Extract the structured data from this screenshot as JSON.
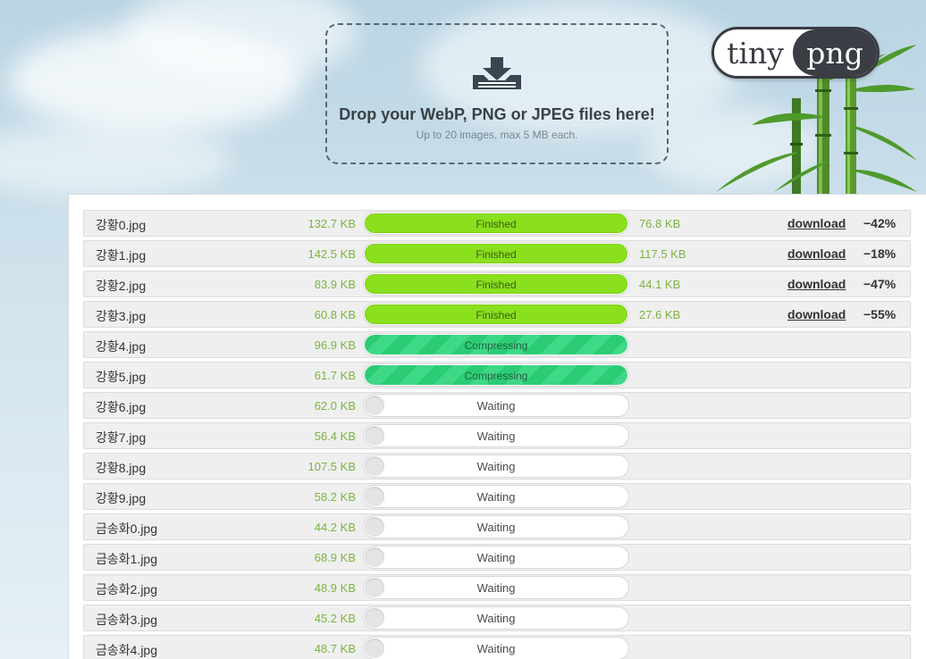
{
  "dropzone": {
    "title": "Drop your WebP, PNG or JPEG files here!",
    "subtitle": "Up to 20 images, max 5 MB each."
  },
  "logo": {
    "part1": "tiny",
    "part2": "png"
  },
  "colors": {
    "finished": "#8ae01d",
    "compressing": "#2bcc74",
    "size_text": "#7cb342"
  },
  "files": [
    {
      "name": "강황0.jpg",
      "original": "132.7 KB",
      "status": "Finished",
      "new_size": "76.8 KB",
      "download": "download",
      "savings": "−42%"
    },
    {
      "name": "강황1.jpg",
      "original": "142.5 KB",
      "status": "Finished",
      "new_size": "117.5 KB",
      "download": "download",
      "savings": "−18%"
    },
    {
      "name": "강황2.jpg",
      "original": "83.9 KB",
      "status": "Finished",
      "new_size": "44.1 KB",
      "download": "download",
      "savings": "−47%"
    },
    {
      "name": "강황3.jpg",
      "original": "60.8 KB",
      "status": "Finished",
      "new_size": "27.6 KB",
      "download": "download",
      "savings": "−55%"
    },
    {
      "name": "강황4.jpg",
      "original": "96.9 KB",
      "status": "Compressing"
    },
    {
      "name": "강황5.jpg",
      "original": "61.7 KB",
      "status": "Compressing"
    },
    {
      "name": "강황6.jpg",
      "original": "62.0 KB",
      "status": "Waiting"
    },
    {
      "name": "강황7.jpg",
      "original": "56.4 KB",
      "status": "Waiting"
    },
    {
      "name": "강황8.jpg",
      "original": "107.5 KB",
      "status": "Waiting"
    },
    {
      "name": "강황9.jpg",
      "original": "58.2 KB",
      "status": "Waiting"
    },
    {
      "name": "금송화0.jpg",
      "original": "44.2 KB",
      "status": "Waiting"
    },
    {
      "name": "금송화1.jpg",
      "original": "68.9 KB",
      "status": "Waiting"
    },
    {
      "name": "금송화2.jpg",
      "original": "48.9 KB",
      "status": "Waiting"
    },
    {
      "name": "금송화3.jpg",
      "original": "45.2 KB",
      "status": "Waiting"
    },
    {
      "name": "금송화4.jpg",
      "original": "48.7 KB",
      "status": "Waiting"
    }
  ]
}
